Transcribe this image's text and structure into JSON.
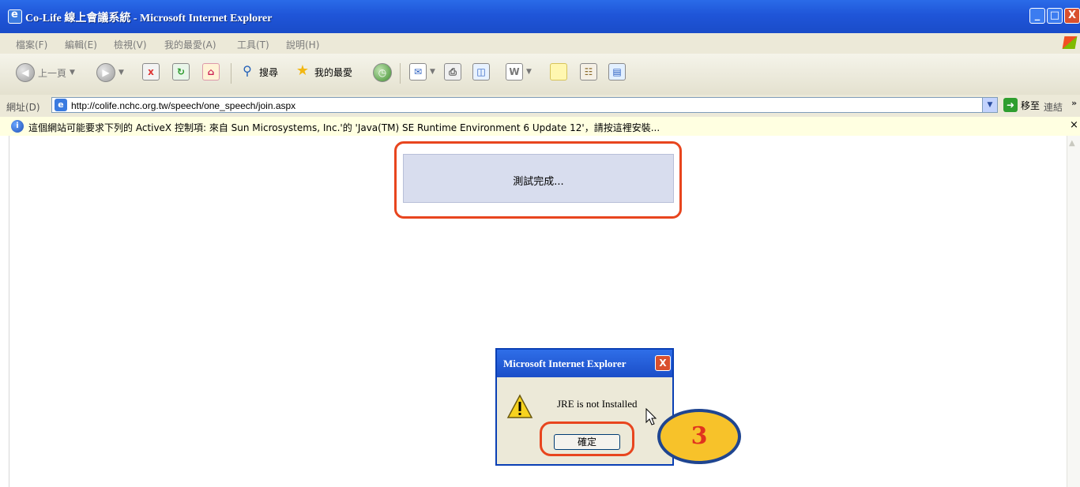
{
  "window": {
    "title": "Co-Life 線上會議系統 - Microsoft Internet Explorer",
    "minimize": "_",
    "maximize": "□",
    "close": "X"
  },
  "menu": {
    "items": [
      "檔案(F)",
      "編輯(E)",
      "檢視(V)",
      "我的最愛(A)",
      "工具(T)",
      "說明(H)"
    ]
  },
  "toolbar": {
    "back_label": "上一頁",
    "search_label": "搜尋",
    "favorites_label": "我的最愛"
  },
  "address": {
    "label": "網址(D)",
    "url": "http://colife.nchc.org.tw/speech/one_speech/join.aspx",
    "go_label": "移至",
    "links_label": "連結",
    "more": "»"
  },
  "infobar": {
    "message": "這個網站可能要求下列的 ActiveX 控制項: 來自 Sun Microsystems, Inc.'的 'Java(TM) SE Runtime Environment 6 Update 12'，請按這裡安裝...",
    "close": "×"
  },
  "page": {
    "status_text": "測試完成..."
  },
  "dialog": {
    "title": "Microsoft Internet Explorer",
    "message": "JRE is not Installed",
    "ok_label": "確定",
    "close": "X"
  },
  "annotation": {
    "step_number": "3",
    "highlight_color": "#e8451e",
    "badge_color": "#f7c22a"
  }
}
